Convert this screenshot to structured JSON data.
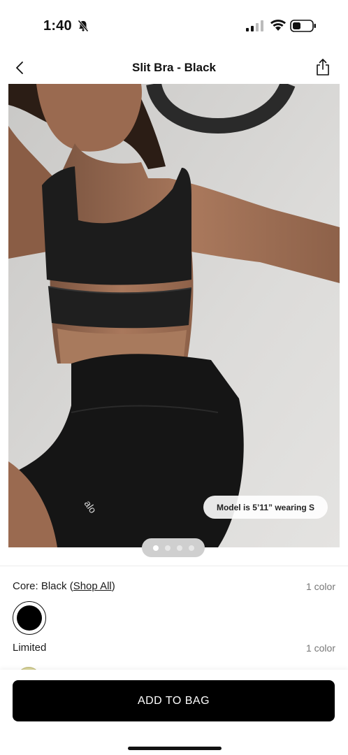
{
  "status": {
    "time": "1:40"
  },
  "nav": {
    "title": "Slit Bra - Black",
    "back_icon": "chevron-left-icon",
    "share_icon": "share-icon"
  },
  "gallery": {
    "model_note": "Model is 5’11” wearing S",
    "page_count": 4,
    "current_page": 1,
    "logo_text": "alo"
  },
  "colors": {
    "core": {
      "label_prefix": "Core: Black (",
      "link": "Shop All",
      "label_suffix": ")",
      "count": "1 color",
      "swatch": "#000000"
    },
    "limited": {
      "label": "Limited",
      "count": "1 color",
      "swatch": "#d8d49a"
    }
  },
  "actions": {
    "add_to_bag": "ADD TO BAG"
  },
  "theme": {
    "accent": "#000000",
    "background": "#ffffff"
  }
}
